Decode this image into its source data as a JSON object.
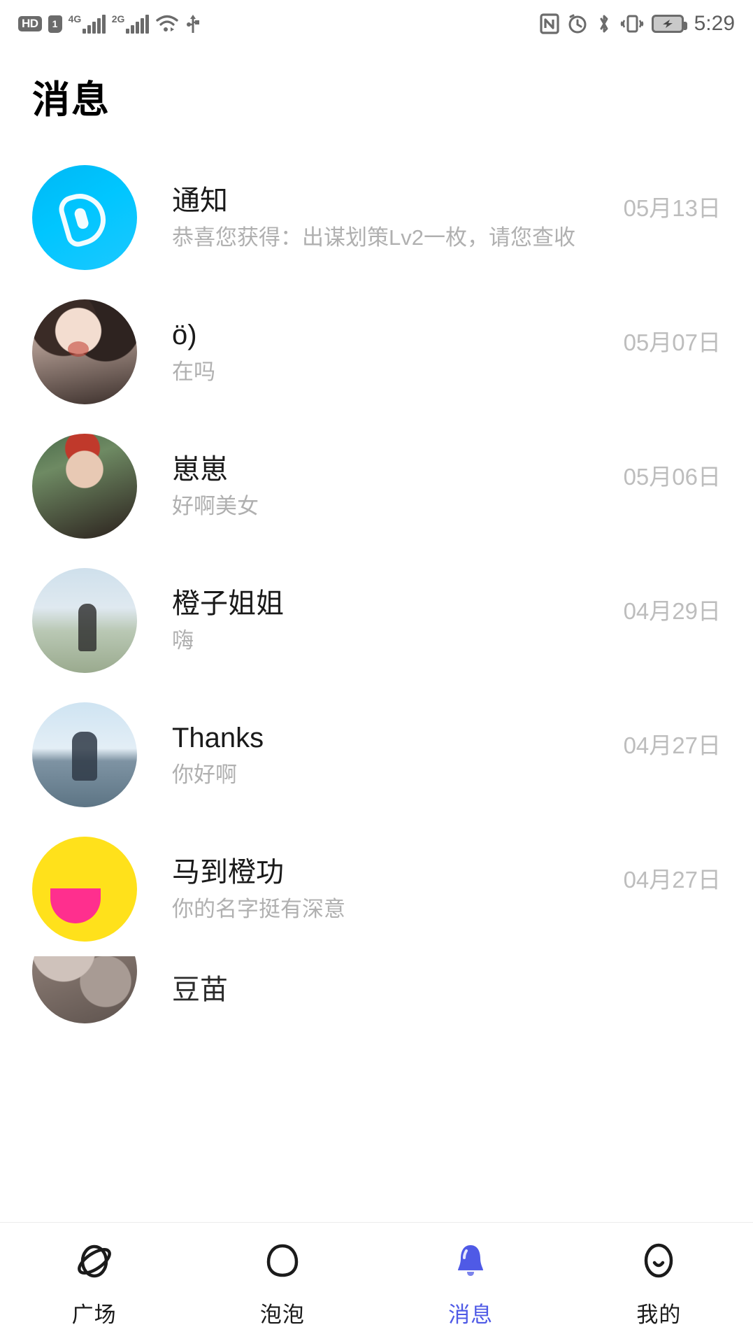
{
  "status_bar": {
    "hd_label": "HD",
    "sim_label": "1",
    "network_1": "4G",
    "network_2": "2G",
    "icons": [
      "hd-icon",
      "sim-card-icon",
      "signal-4g-icon",
      "signal-2g-icon",
      "wifi-icon",
      "usb-icon",
      "nfc-icon",
      "alarm-icon",
      "bluetooth-icon",
      "vibrate-icon",
      "battery-charging-icon"
    ],
    "time": "5:29"
  },
  "header": {
    "title": "消息"
  },
  "conversations": [
    {
      "name": "通知",
      "preview": "恭喜您获得：出谋划策Lv2一枚，请您查收",
      "date": "05月13日",
      "avatar": "notification-megaphone-avatar",
      "avatar_class": "av-notice"
    },
    {
      "name": "ö)",
      "preview": "在吗",
      "date": "05月07日",
      "avatar": "photo-avatar",
      "avatar_class": "av-p1"
    },
    {
      "name": "崽崽",
      "preview": "好啊美女",
      "date": "05月06日",
      "avatar": "photo-avatar",
      "avatar_class": "av-p2"
    },
    {
      "name": "橙子姐姐",
      "preview": "嗨",
      "date": "04月29日",
      "avatar": "photo-avatar",
      "avatar_class": "av-p3"
    },
    {
      "name": "Thanks",
      "preview": "你好啊",
      "date": "04月27日",
      "avatar": "photo-avatar",
      "avatar_class": "av-p4"
    },
    {
      "name": "马到橙功",
      "preview": "你的名字挺有深意",
      "date": "04月27日",
      "avatar": "yellow-face-avatar",
      "avatar_class": "av-yellow"
    },
    {
      "name": "豆苗",
      "preview": "",
      "date": "",
      "avatar": "photo-avatar",
      "avatar_class": "av-rock"
    }
  ],
  "tabbar": {
    "items": [
      {
        "label": "广场",
        "icon": "planet-icon",
        "active": false
      },
      {
        "label": "泡泡",
        "icon": "bubble-icon",
        "active": false
      },
      {
        "label": "消息",
        "icon": "bell-icon",
        "active": true
      },
      {
        "label": "我的",
        "icon": "face-icon",
        "active": false
      }
    ],
    "active_color": "#4f5ae6"
  }
}
